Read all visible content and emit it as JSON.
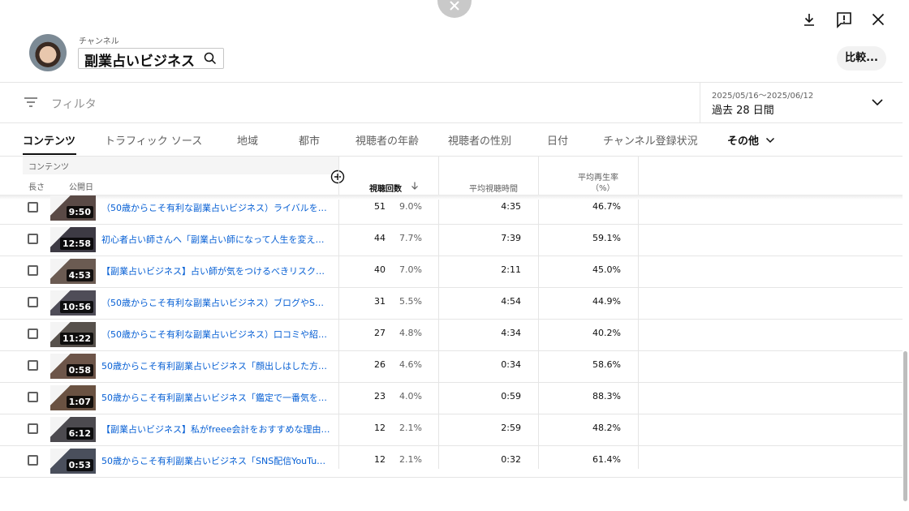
{
  "header": {
    "channel_label": "チャンネル",
    "channel_name": "副業占いビジネス",
    "compare_label": "比較..."
  },
  "filter": {
    "placeholder": "フィルタ",
    "date_range": "2025/05/16～2025/06/12",
    "date_label": "過去 28 日間"
  },
  "tabs": [
    {
      "label": "コンテンツ",
      "active": true
    },
    {
      "label": "トラフィック ソース"
    },
    {
      "label": "地域"
    },
    {
      "label": "都市"
    },
    {
      "label": "視聴者の年齢"
    },
    {
      "label": "視聴者の性別"
    },
    {
      "label": "日付"
    },
    {
      "label": "チャンネル登録状況"
    },
    {
      "label": "その他"
    }
  ],
  "table": {
    "group_label": "コンテンツ",
    "col_length": "長さ",
    "col_published": "公開日",
    "col_views": "視聴回数",
    "col_avg_time": "平均視聴時間",
    "col_avg_pct_line1": "平均再生率",
    "col_avg_pct_line2": "（%）",
    "rows": [
      {
        "duration": "9:50",
        "title": "（50歳からこそ有利な副業占いビジネス）ライバルを…",
        "views": "51",
        "pct": "9.0%",
        "avg_time": "4:35",
        "avg_pct": "46.7%"
      },
      {
        "duration": "12:58",
        "title": "初心者占い師さんへ「副業占い師になって人生を変え…",
        "views": "44",
        "pct": "7.7%",
        "avg_time": "7:39",
        "avg_pct": "59.1%"
      },
      {
        "duration": "4:53",
        "title": "【副業占いビジネス】占い師が気をつけるべきリスク…",
        "views": "40",
        "pct": "7.0%",
        "avg_time": "2:11",
        "avg_pct": "45.0%"
      },
      {
        "duration": "10:56",
        "title": "（50歳からこそ有利な副業占いビジネス）ブログやS…",
        "views": "31",
        "pct": "5.5%",
        "avg_time": "4:54",
        "avg_pct": "44.9%"
      },
      {
        "duration": "11:22",
        "title": "（50歳からこそ有利な副業占いビジネス）口コミや紹…",
        "views": "27",
        "pct": "4.8%",
        "avg_time": "4:34",
        "avg_pct": "40.2%"
      },
      {
        "duration": "0:58",
        "title": "50歳からこそ有利副業占いビジネス「顔出しはした方…",
        "views": "26",
        "pct": "4.6%",
        "avg_time": "0:34",
        "avg_pct": "58.6%"
      },
      {
        "duration": "1:07",
        "title": "50歳からこそ有利副業占いビジネス「鑑定で一番気を…",
        "views": "23",
        "pct": "4.0%",
        "avg_time": "0:59",
        "avg_pct": "88.3%"
      },
      {
        "duration": "6:12",
        "title": "【副業占いビジネス】私がfreee会計をおすすめな理由…",
        "views": "12",
        "pct": "2.1%",
        "avg_time": "2:59",
        "avg_pct": "48.2%"
      },
      {
        "duration": "0:53",
        "title": "50歳からこそ有利副業占いビジネス「SNS配信YouTu…",
        "views": "12",
        "pct": "2.1%",
        "avg_time": "0:32",
        "avg_pct": "61.4%"
      }
    ]
  }
}
